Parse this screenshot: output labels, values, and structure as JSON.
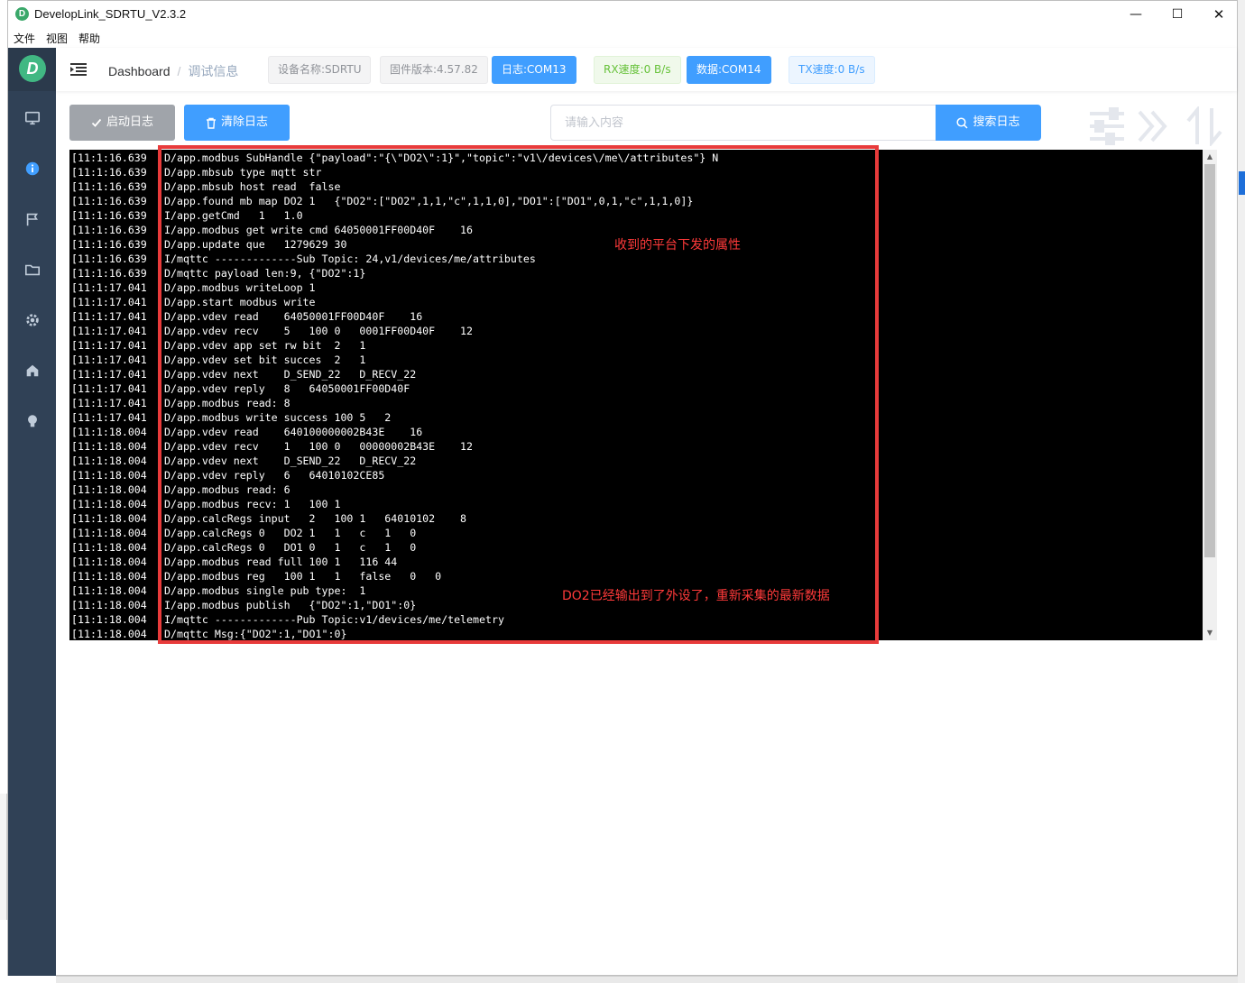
{
  "window": {
    "title": "DevelopLink_SDRTU_V2.3.2",
    "app_icon_letter": "D",
    "controls": {
      "minimize": "—",
      "maximize": "☐",
      "close": "✕"
    }
  },
  "menubar": {
    "items": [
      "文件",
      "视图",
      "帮助"
    ]
  },
  "sidebar": {
    "logo_letter": "D",
    "icons": [
      "monitor-icon",
      "info-icon",
      "flag-icon",
      "folder-icon",
      "gear-icon",
      "home-icon",
      "bulb-icon"
    ]
  },
  "navbar": {
    "breadcrumb": {
      "home": "Dashboard",
      "separator": "/",
      "current": "调试信息"
    },
    "tags": {
      "device_name": "设备名称:SDRTU",
      "firmware": "固件版本:4.57.82",
      "log_port": "日志:COM13",
      "rx_speed": "RX速度:0 B/s",
      "data_port": "数据:COM14",
      "tx_speed": "TX速度:0 B/s"
    }
  },
  "toolbar": {
    "start_label": "启动日志",
    "clear_label": "清除日志",
    "search_placeholder": "请输入内容",
    "search_value": "",
    "search_label": "搜索日志"
  },
  "log": {
    "lines": [
      {
        "ts": "[11:1:16.639",
        "msg": "D/app.modbus SubHandle {\"payload\":\"{\\\"DO2\\\":1}\",\"topic\":\"v1\\/devices\\/me\\/attributes\"} N"
      },
      {
        "ts": "[11:1:16.639",
        "msg": "D/app.mbsub type mqtt str"
      },
      {
        "ts": "[11:1:16.639",
        "msg": "D/app.mbsub host read  false"
      },
      {
        "ts": "[11:1:16.639",
        "msg": "D/app.found mb map DO2 1   {\"DO2\":[\"DO2\",1,1,\"c\",1,1,0],\"DO1\":[\"DO1\",0,1,\"c\",1,1,0]}"
      },
      {
        "ts": "[11:1:16.639",
        "msg": "I/app.getCmd   1   1.0"
      },
      {
        "ts": "[11:1:16.639",
        "msg": "I/app.modbus get write cmd 64050001FF00D40F    16"
      },
      {
        "ts": "[11:1:16.639",
        "msg": "D/app.update que   1279629 30"
      },
      {
        "ts": "[11:1:16.639",
        "msg": "I/mqttc -------------Sub Topic: 24,v1/devices/me/attributes"
      },
      {
        "ts": "[11:1:16.639",
        "msg": "D/mqttc payload len:9, {\"DO2\":1}"
      },
      {
        "ts": "[11:1:17.041",
        "msg": "D/app.modbus writeLoop 1"
      },
      {
        "ts": "[11:1:17.041",
        "msg": "D/app.start modbus write"
      },
      {
        "ts": "[11:1:17.041",
        "msg": "D/app.vdev read    64050001FF00D40F    16"
      },
      {
        "ts": "[11:1:17.041",
        "msg": "D/app.vdev recv    5   100 0   0001FF00D40F    12"
      },
      {
        "ts": "[11:1:17.041",
        "msg": "D/app.vdev app set rw bit  2   1"
      },
      {
        "ts": "[11:1:17.041",
        "msg": "D/app.vdev set bit succes  2   1"
      },
      {
        "ts": "[11:1:17.041",
        "msg": "D/app.vdev next    D_SEND_22   D_RECV_22"
      },
      {
        "ts": "[11:1:17.041",
        "msg": "D/app.vdev reply   8   64050001FF00D40F"
      },
      {
        "ts": "[11:1:17.041",
        "msg": "D/app.modbus read: 8"
      },
      {
        "ts": "[11:1:17.041",
        "msg": "D/app.modbus write success 100 5   2"
      },
      {
        "ts": "[11:1:18.004",
        "msg": "D/app.vdev read    640100000002B43E    16"
      },
      {
        "ts": "[11:1:18.004",
        "msg": "D/app.vdev recv    1   100 0   00000002B43E    12"
      },
      {
        "ts": "[11:1:18.004",
        "msg": "D/app.vdev next    D_SEND_22   D_RECV_22"
      },
      {
        "ts": "[11:1:18.004",
        "msg": "D/app.vdev reply   6   64010102CE85"
      },
      {
        "ts": "[11:1:18.004",
        "msg": "D/app.modbus read: 6"
      },
      {
        "ts": "[11:1:18.004",
        "msg": "D/app.modbus recv: 1   100 1"
      },
      {
        "ts": "[11:1:18.004",
        "msg": "D/app.calcRegs input   2   100 1   64010102    8"
      },
      {
        "ts": "[11:1:18.004",
        "msg": "D/app.calcRegs 0   DO2 1   1   c   1   0"
      },
      {
        "ts": "[11:1:18.004",
        "msg": "D/app.calcRegs 0   DO1 0   1   c   1   0"
      },
      {
        "ts": "[11:1:18.004",
        "msg": "D/app.modbus read full 100 1   116 44"
      },
      {
        "ts": "[11:1:18.004",
        "msg": "D/app.modbus reg   100 1   1   false   0   0"
      },
      {
        "ts": "[11:1:18.004",
        "msg": "D/app.modbus single pub type:  1"
      },
      {
        "ts": "[11:1:18.004",
        "msg": "I/app.modbus publish   {\"DO2\":1,\"DO1\":0}"
      },
      {
        "ts": "[11:1:18.004",
        "msg": "I/mqttc -------------Pub Topic:v1/devices/me/telemetry"
      },
      {
        "ts": "[11:1:18.004",
        "msg": "D/mqttc Msg:{\"DO2\":1,\"DO1\":0}"
      }
    ]
  },
  "annotations": {
    "received_note": "收到的平台下发的属性",
    "output_note": "DO2已经输出到了外设了，重新采集的最新数据"
  },
  "colors": {
    "sidebar_bg": "#304156",
    "primary": "#409eff",
    "success": "#67c23a",
    "annotation": "#e83b3b",
    "console_bg": "#000000"
  }
}
